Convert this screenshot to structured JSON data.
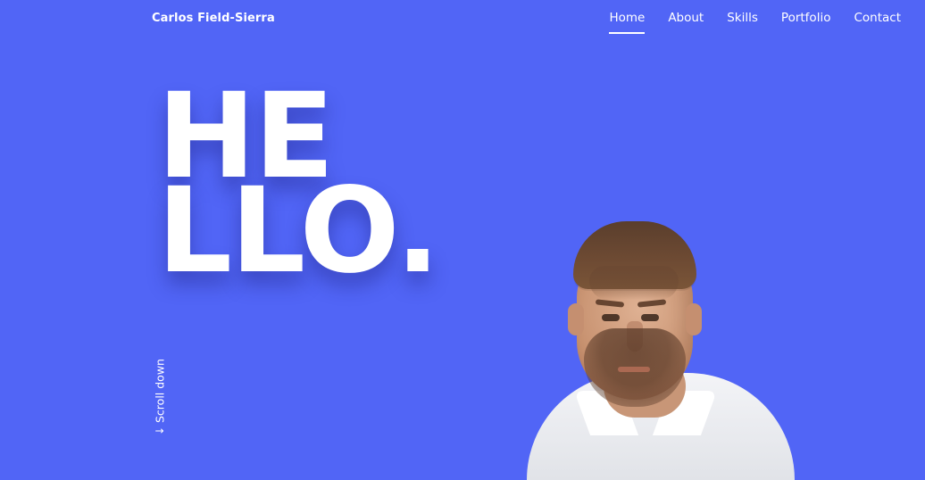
{
  "site": {
    "brand": "Carlos Field-Sierra"
  },
  "nav": {
    "items": [
      {
        "label": "Home",
        "active": true
      },
      {
        "label": "About",
        "active": false
      },
      {
        "label": "Skills",
        "active": false
      },
      {
        "label": "Portfolio",
        "active": false
      },
      {
        "label": "Contact",
        "active": false
      }
    ]
  },
  "hero": {
    "line1": "HE",
    "line2": "LLO",
    "dot": "."
  },
  "scroll": {
    "label": "Scroll down",
    "arrow": "↓"
  },
  "colors": {
    "background": "#5165f6",
    "text": "#ffffff"
  },
  "icons": {
    "scroll_arrow": "arrow-down-icon"
  }
}
